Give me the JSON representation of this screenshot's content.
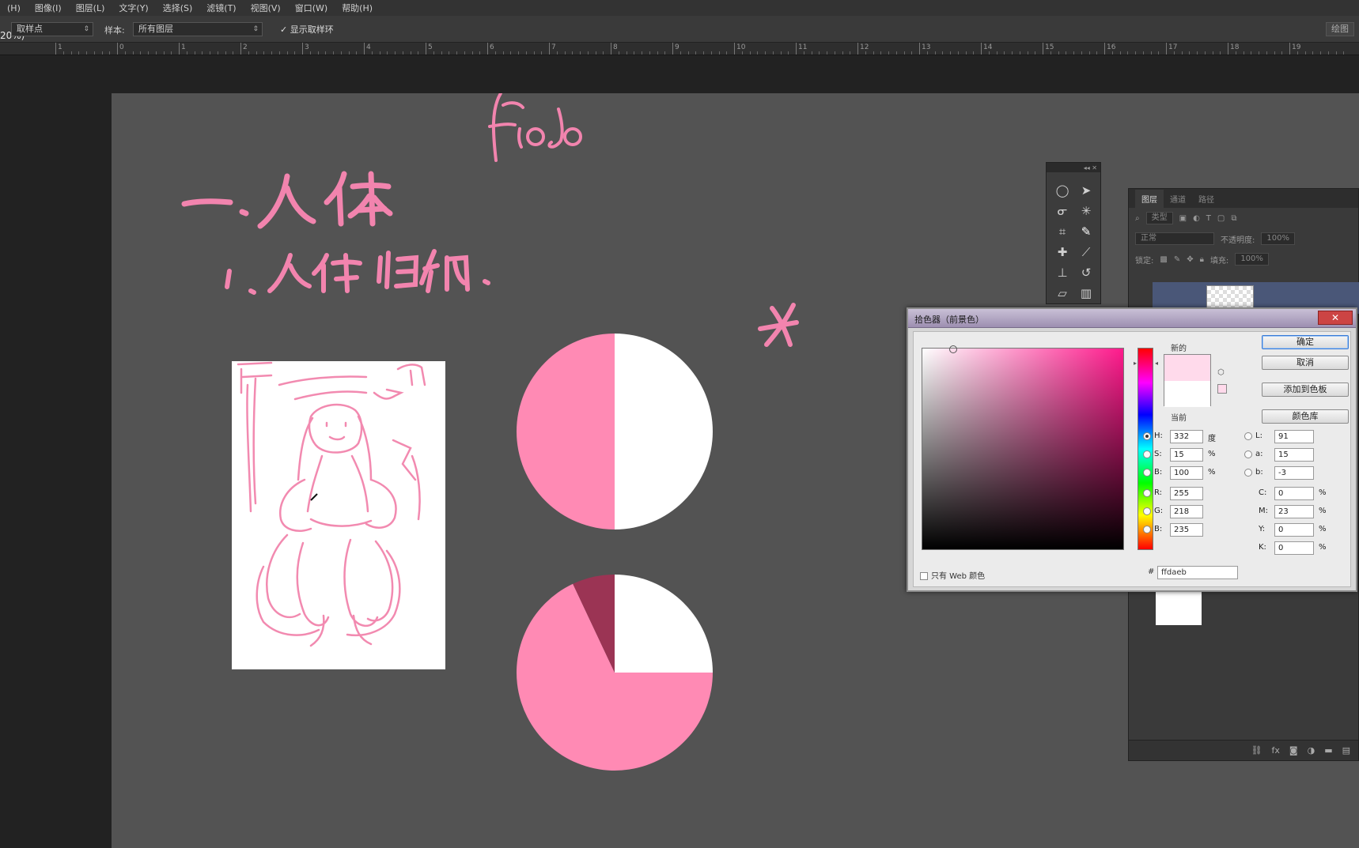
{
  "menu": [
    "(H)",
    "图像(I)",
    "图层(L)",
    "文字(Y)",
    "选择(S)",
    "滤镜(T)",
    "视图(V)",
    "窗口(W)",
    "帮助(H)"
  ],
  "options": {
    "zoom_text": "20%)",
    "sample_size": "取样点",
    "sample_label": "样本:",
    "sample_value": "所有图层",
    "show_ring_label": "显示取样环",
    "right_button": "绘图"
  },
  "ruler": {
    "labels": [
      "1",
      "0",
      "1",
      "2",
      "3",
      "4",
      "5",
      "6",
      "7",
      "8",
      "9",
      "10",
      "11",
      "12",
      "13",
      "14",
      "15",
      "16",
      "17",
      "18",
      "19"
    ]
  },
  "canvas": {
    "handwriting_title": "fiodo",
    "heading": "一、人体",
    "subheading": "1、人体归纳、",
    "cross_mark": "×",
    "pie_top": {
      "pink_fraction": 0.5,
      "pink": "#ff8ab4",
      "white": "#ffffff"
    },
    "pie_bottom": {
      "white_fraction": 0.25,
      "dark_fraction": 0.07,
      "pink": "#ff8ab4",
      "dark": "#9b3454",
      "white": "#ffffff"
    },
    "sketch_color": "#f28ab0"
  },
  "tools": {
    "icons": [
      "ellipse-marquee",
      "move",
      "lasso",
      "magic-wand",
      "crop",
      "eyedropper",
      "healing-brush",
      "brush",
      "clone-stamp",
      "history-brush",
      "eraser",
      "gradient"
    ]
  },
  "layers": {
    "tabs": [
      "图层",
      "通道",
      "路径"
    ],
    "filter_label": "类型",
    "blend_mode": "正常",
    "opacity_label": "不透明度:",
    "opacity_value": "100%",
    "lock_label": "锁定:",
    "fill_label": "填充:",
    "fill_value": "100%",
    "footer_icons": [
      "link",
      "fx",
      "mask",
      "adjust",
      "folder",
      "new"
    ]
  },
  "color_picker": {
    "title": "拾色器（前景色）",
    "close": "✕",
    "new_label": "新的",
    "current_label": "当前",
    "new_color": "#ffdaeb",
    "current_color": "#ffffff",
    "buttons": {
      "ok": "确定",
      "cancel": "取消",
      "add_swatch": "添加到色板",
      "libraries": "颜色库"
    },
    "hsb": {
      "h": {
        "label": "H:",
        "value": "332",
        "unit": "度"
      },
      "s": {
        "label": "S:",
        "value": "15",
        "unit": "%"
      },
      "b": {
        "label": "B:",
        "value": "100",
        "unit": "%"
      }
    },
    "rgb": {
      "r": {
        "label": "R:",
        "value": "255"
      },
      "g": {
        "label": "G:",
        "value": "218"
      },
      "b": {
        "label": "B:",
        "value": "235"
      }
    },
    "lab": {
      "l": {
        "label": "L:",
        "value": "91"
      },
      "a": {
        "label": "a:",
        "value": "15"
      },
      "b": {
        "label": "b:",
        "value": "-3"
      }
    },
    "cmyk": {
      "c": {
        "label": "C:",
        "value": "0",
        "unit": "%"
      },
      "m": {
        "label": "M:",
        "value": "23",
        "unit": "%"
      },
      "y": {
        "label": "Y:",
        "value": "0",
        "unit": "%"
      },
      "k": {
        "label": "K:",
        "value": "0",
        "unit": "%"
      }
    },
    "web_only": "只有 Web 颜色",
    "hex_label": "#",
    "hex_value": "ffdaeb"
  }
}
